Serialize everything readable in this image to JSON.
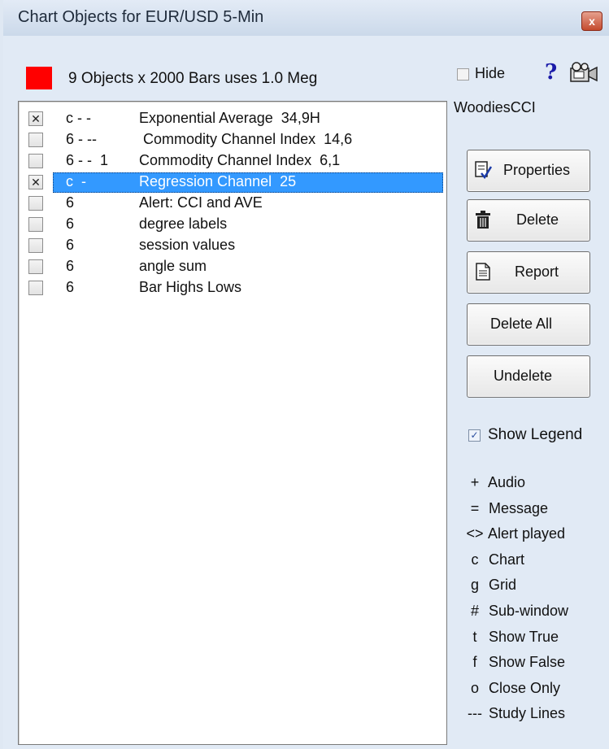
{
  "window": {
    "title": "Chart Objects for EUR/USD 5-Min",
    "close_glyph": "x"
  },
  "summary": {
    "color": "#ff0000",
    "text": "9 Objects x 2000 Bars uses 1.0 Meg"
  },
  "objects": [
    {
      "checked": true,
      "code": "c - -",
      "name": "Exponential Average  34,9H",
      "selected": false
    },
    {
      "checked": false,
      "code": "6 - --",
      "name": " Commodity Channel Index  14,6",
      "selected": false
    },
    {
      "checked": false,
      "code": "6 - -  1",
      "name": "Commodity Channel Index  6,1",
      "selected": false
    },
    {
      "checked": true,
      "code": "c  -",
      "name": "Regression Channel  25",
      "selected": true
    },
    {
      "checked": false,
      "code": "6",
      "name": "Alert: CCI and AVE",
      "selected": false
    },
    {
      "checked": false,
      "code": "6",
      "name": "degree labels",
      "selected": false
    },
    {
      "checked": false,
      "code": "6",
      "name": "session values",
      "selected": false
    },
    {
      "checked": false,
      "code": "6",
      "name": "angle sum",
      "selected": false
    },
    {
      "checked": false,
      "code": "6",
      "name": "Bar Highs Lows",
      "selected": false
    }
  ],
  "hide": {
    "label": "Hide",
    "checked": false
  },
  "help_glyph": "?",
  "study_name": "WoodiesCCI",
  "buttons": {
    "properties": "Properties",
    "delete": "Delete",
    "report": "Report",
    "delete_all": "Delete All",
    "undelete": "Undelete"
  },
  "show_legend": {
    "label": "Show Legend",
    "checked": true
  },
  "legend": [
    {
      "symbol": "+",
      "text": "Audio"
    },
    {
      "symbol": "=",
      "text": "Message"
    },
    {
      "symbol": "<>",
      "text": "Alert played"
    },
    {
      "symbol": "c",
      "text": "Chart"
    },
    {
      "symbol": "g",
      "text": "Grid"
    },
    {
      "symbol": "#",
      "text": "Sub-window"
    },
    {
      "symbol": "t",
      "text": "Show True"
    },
    {
      "symbol": "f",
      "text": "Show False"
    },
    {
      "symbol": "o",
      "text": "Close Only"
    },
    {
      "symbol": "---",
      "text": "Study Lines"
    }
  ],
  "icons": {
    "properties": "properties-icon",
    "delete": "trash-icon",
    "report": "report-icon",
    "camera": "camera-icon",
    "help": "help-icon"
  }
}
